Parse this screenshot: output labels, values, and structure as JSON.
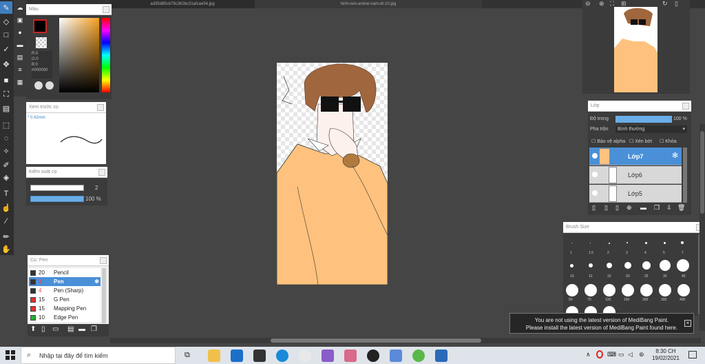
{
  "tabs": {
    "left": "ad35d85cb79c362bc31afcae54.jpg",
    "center": "hinh-nen-anime-nam-dt-10.jpg"
  },
  "color_panel": {
    "title": "Màu",
    "r": "R:0",
    "g": "G:0",
    "b": "B:0",
    "hex": "#000000"
  },
  "preview_panel": {
    "title": "Xem trước cọ",
    "size": "0.42mm"
  },
  "brush_control": {
    "title": "Kiểm soát cọ",
    "size_value": "2",
    "opacity_value": "100 %"
  },
  "pen_panel": {
    "title": "Cọ: Pen",
    "items": [
      {
        "size": "20",
        "name": "Pencil",
        "color": "#333333"
      },
      {
        "size": "2",
        "name": "Pen",
        "color": "#333333"
      },
      {
        "size": "4",
        "name": "Pen (Sharp)",
        "color": "#333333"
      },
      {
        "size": "15",
        "name": "G Pen",
        "color": "#e03030"
      },
      {
        "size": "15",
        "name": "Mapping Pen",
        "color": "#e03030"
      },
      {
        "size": "10",
        "name": "Edge Pen",
        "color": "#20b030"
      }
    ]
  },
  "layer_panel": {
    "title": "Lớp",
    "opacity_label": "Độ trong",
    "opacity_value": "100 %",
    "blend_label": "Pha trộn",
    "blend_value": "Bình thường",
    "protect_alpha": "Bảo vệ alpha",
    "clipping": "Xén bớt",
    "lock": "Khóa",
    "layers": [
      {
        "name": "Lớp7"
      },
      {
        "name": "Lớp6"
      },
      {
        "name": "Lớp5"
      }
    ]
  },
  "brush_size_panel": {
    "title": "Brush Size",
    "row1": [
      "1",
      "1.5",
      "2",
      "3",
      "4",
      "5",
      "7"
    ],
    "row2": [
      "10",
      "12",
      "15",
      "20",
      "25",
      "30",
      "40"
    ],
    "row3": [
      "50",
      "70",
      "100",
      "150",
      "200",
      "300",
      "400"
    ]
  },
  "notification": {
    "line1": "You are not using the latest version of MediBang Paint.",
    "line2": "Please install the latest version of MediBang Paint found here."
  },
  "taskbar": {
    "search_placeholder": "Nhập tại đây để tìm kiếm",
    "time": "8:30 CH",
    "date": "19/02/2021"
  },
  "colors": {
    "accent": "#5a9fd8",
    "sweater": "#fec27e",
    "hair": "#a0663e"
  }
}
